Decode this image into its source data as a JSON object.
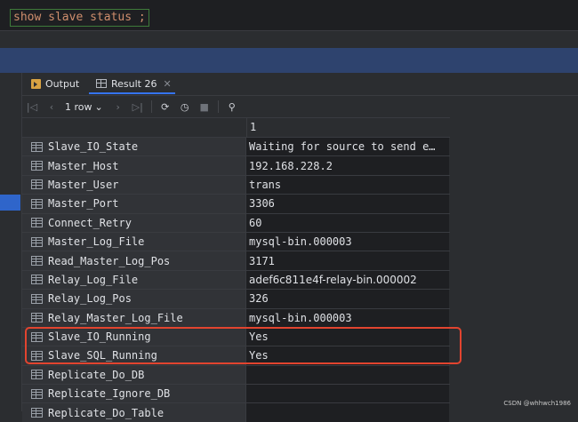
{
  "editor": {
    "query": "show slave status ;"
  },
  "tabs": [
    {
      "label": "Output"
    },
    {
      "label": "Result 26"
    }
  ],
  "toolbar": {
    "rows": "1 row"
  },
  "grid": {
    "column_header": "1",
    "rows": [
      {
        "name": "Slave_IO_State",
        "value": "Waiting for source to send e…"
      },
      {
        "name": "Master_Host",
        "value": "192.168.228.2"
      },
      {
        "name": "Master_User",
        "value": "trans"
      },
      {
        "name": "Master_Port",
        "value": "3306"
      },
      {
        "name": "Connect_Retry",
        "value": "60"
      },
      {
        "name": "Master_Log_File",
        "value": "mysql-bin.000003"
      },
      {
        "name": "Read_Master_Log_Pos",
        "value": "3171"
      },
      {
        "name": "Relay_Log_File",
        "value": "adef6c811e4f-relay-bin.000002"
      },
      {
        "name": "Relay_Log_Pos",
        "value": "326"
      },
      {
        "name": "Relay_Master_Log_File",
        "value": "mysql-bin.000003"
      },
      {
        "name": "Slave_IO_Running",
        "value": "Yes"
      },
      {
        "name": "Slave_SQL_Running",
        "value": "Yes"
      },
      {
        "name": "Replicate_Do_DB",
        "value": ""
      },
      {
        "name": "Replicate_Ignore_DB",
        "value": ""
      },
      {
        "name": "Replicate_Do_Table",
        "value": ""
      }
    ]
  },
  "watermark": "CSDN @whhwch1986",
  "colors": {
    "highlight_box": "#e2442f",
    "selection": "#2f65ca"
  }
}
